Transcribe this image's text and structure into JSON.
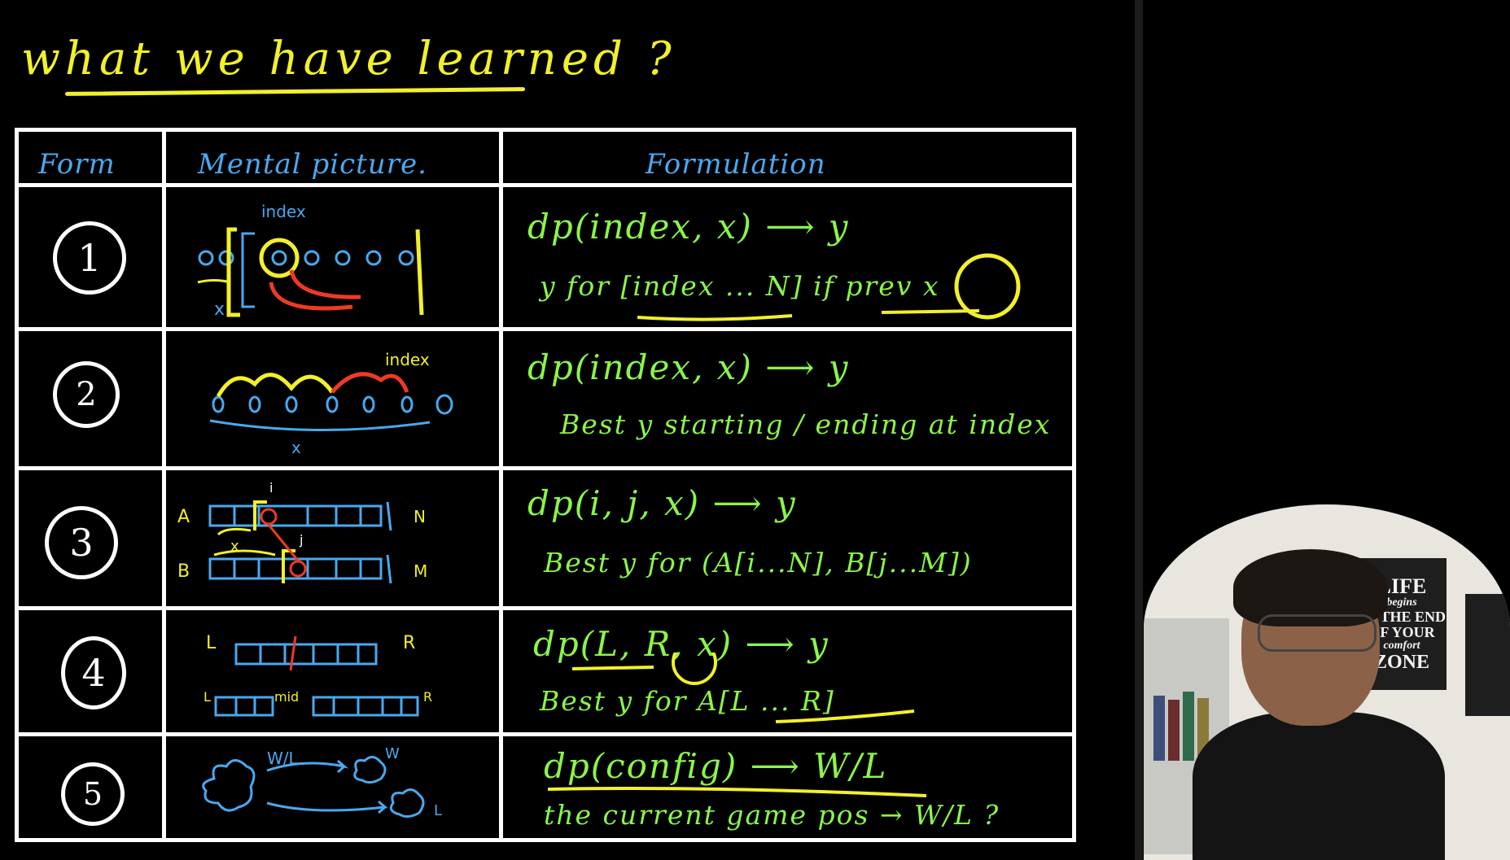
{
  "title": "what we have learned ?",
  "headers": {
    "form": "Form",
    "mental": "Mental picture.",
    "formulation": "Formulation"
  },
  "rows": [
    {
      "num": "1",
      "f1": "dp(index, x) ⟶ y",
      "f2": "y for [index ... N] if prev x",
      "labels": {
        "index": "index",
        "x": "x"
      }
    },
    {
      "num": "2",
      "f1": "dp(index, x) ⟶ y",
      "f2": "Best y starting / ending at index",
      "labels": {
        "index": "index",
        "x": "x"
      }
    },
    {
      "num": "3",
      "f1": "dp(i, j, x) ⟶ y",
      "f2": "Best y for (A[i...N], B[j...M])",
      "labels": {
        "A": "A",
        "B": "B",
        "N": "N",
        "M": "M",
        "i": "i",
        "j": "j",
        "x": "x"
      }
    },
    {
      "num": "4",
      "f1": "dp(L, R, x) ⟶ y",
      "f2": "Best y for A[L ... R]",
      "labels": {
        "L": "L",
        "R": "R",
        "mid": "mid"
      }
    },
    {
      "num": "5",
      "f1": "dp(config) ⟶ W/L",
      "f2": "the current game pos → W/L ?",
      "labels": {
        "wl": "W/L",
        "w": "W",
        "l": "L"
      }
    }
  ],
  "colors": {
    "yellow": "#f2f02a",
    "blue": "#4aa8ef",
    "green": "#8af54a",
    "red": "#ef3a22",
    "white": "#ffffff"
  },
  "webcam": {
    "poster_lines": [
      "LIFE",
      "begins",
      "AT THE END",
      "OF YOUR",
      "comfort",
      "ZONE"
    ]
  }
}
